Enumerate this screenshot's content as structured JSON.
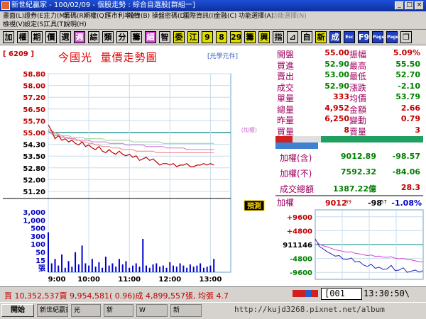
{
  "window": {
    "title": "新世紀贏家 - 100/02/09 - 個股走勢 : 綜合自選股[群組一]"
  },
  "menu": {
    "row1": [
      "畫面(L)",
      "證券(E)",
      "主力(M)",
      "籌碼(R)",
      "期權(Q)",
      "匯市利率(F)",
      "投資(B)",
      "操盤密碼(D)",
      "國際資訊(I)",
      "金融(C)",
      "功能選擇(A)",
      "功能選擇(N)"
    ],
    "row2": [
      "檢視(V)",
      "設定(S)",
      "工具(T)",
      "說明(H)"
    ]
  },
  "toolbar": {
    "buttons": [
      {
        "label": "加",
        "bg": "#d6d3ce",
        "fg": "#000000"
      },
      {
        "label": "權",
        "bg": "#d6d3ce",
        "fg": "#000000"
      },
      {
        "label": "期",
        "bg": "#d6d3ce",
        "fg": "#000000"
      },
      {
        "label": "價",
        "bg": "#d6d3ce",
        "fg": "#000000"
      },
      {
        "label": "選",
        "bg": "#d6d3ce",
        "fg": "#000000"
      },
      {
        "label": "週",
        "bg": "#d050d0",
        "fg": "#ffffff"
      },
      {
        "label": "綜",
        "bg": "#d6d3ce",
        "fg": "#000000"
      },
      {
        "label": "類",
        "bg": "#d6d3ce",
        "fg": "#000000"
      },
      {
        "label": "分",
        "bg": "#d6d3ce",
        "fg": "#000000"
      },
      {
        "label": "籌",
        "bg": "#d6d3ce",
        "fg": "#000000"
      },
      {
        "label": "細",
        "bg": "#d050d0",
        "fg": "#ffffff"
      },
      {
        "label": "智",
        "bg": "#d6d3ce",
        "fg": "#000000"
      },
      {
        "label": "委",
        "bg": "#e0e000",
        "fg": "#000000"
      },
      {
        "label": "江",
        "bg": "#e0e000",
        "fg": "#000000"
      },
      {
        "label": "9",
        "bg": "#e0e000",
        "fg": "#000000"
      },
      {
        "label": "8",
        "bg": "#e0e000",
        "fg": "#000000"
      },
      {
        "label": "29",
        "bg": "#e0e000",
        "fg": "#000000"
      },
      {
        "label": "籌",
        "bg": "#e0e000",
        "fg": "#000000"
      },
      {
        "label": "興",
        "bg": "#e0e000",
        "fg": "#000000"
      },
      {
        "label": "指",
        "bg": "#d6d3ce",
        "fg": "#000000"
      },
      {
        "label": "⊿",
        "bg": "#d6d3ce",
        "fg": "#000000"
      },
      {
        "label": "自",
        "bg": "#d6d3ce",
        "fg": "#000000"
      },
      {
        "label": "新",
        "bg": "#e0e000",
        "fg": "#000000"
      },
      {
        "label": "成",
        "bg": "#2040c0",
        "fg": "#ffffff"
      },
      {
        "label": "Esc",
        "bg": "#2040c0",
        "fg": "#ffffff"
      },
      {
        "label": "F9",
        "bg": "#2040c0",
        "fg": "#ffffff"
      },
      {
        "label": "Page",
        "bg": "#2040c0",
        "fg": "#ffffff"
      },
      {
        "label": "Page",
        "bg": "#2040c0",
        "fg": "#ffffff"
      },
      {
        "label": "❐",
        "bg": "#d6d3ce",
        "fg": "#000000"
      }
    ]
  },
  "stock": {
    "code": "[ 6209 ]",
    "name": "今國光",
    "chart_title": "量價走勢圖",
    "unit": "[光學元件]",
    "index_tag": "(加權)",
    "predict_tag": "預測"
  },
  "quote": {
    "fields": [
      {
        "label": "開盤",
        "value": "55.00",
        "color": "#c00000"
      },
      {
        "label": "振幅",
        "value": "5.09%",
        "color": "#c00000"
      },
      {
        "label": "買進",
        "value": "52.90",
        "color": "#008000"
      },
      {
        "label": "最高",
        "value": "55.50",
        "color": "#008000"
      },
      {
        "label": "賣出",
        "value": "53.00",
        "color": "#008000"
      },
      {
        "label": "最低",
        "value": "52.70",
        "color": "#008000"
      },
      {
        "label": "成交",
        "value": "52.90",
        "color": "#008000"
      },
      {
        "label": "漲跌",
        "value": "-2.10",
        "color": "#008000"
      },
      {
        "label": "單量",
        "value": "333",
        "color": "#c00000"
      },
      {
        "label": "均價",
        "value": "53.79",
        "color": "#008000"
      },
      {
        "label": "總量",
        "value": "4,952",
        "color": "#c00000"
      },
      {
        "label": "金額",
        "value": "2.66",
        "color": "#c00000"
      },
      {
        "label": "昨量",
        "value": "6,250",
        "color": "#c00000"
      },
      {
        "label": "變動",
        "value": "0.79",
        "color": "#c00000"
      },
      {
        "label": "買量",
        "value": "8",
        "color": "#c00000"
      },
      {
        "label": "賣量",
        "value": "3",
        "color": "#c00000"
      }
    ]
  },
  "index_table": [
    {
      "label": "加權(含)",
      "value": "9012.89",
      "change": "-98.57"
    },
    {
      "label": "加權(不)",
      "value": "7592.32",
      "change": "-84.06"
    },
    {
      "label": "成交總額",
      "value": "1387.22億",
      "change": "28.3"
    }
  ],
  "index_chart": {
    "header": {
      "label": "加權",
      "value": "9012",
      "value_small": "89",
      "change": "-98",
      "change_small": "57",
      "pct": "-1.08%"
    },
    "ticks": [
      "+9600",
      "+4800",
      "911146",
      "-4800",
      "-9600"
    ]
  },
  "chart_data": [
    {
      "type": "line",
      "title": "量價走勢圖",
      "x_ticks": [
        "9:00",
        "10:00",
        "11:00",
        "12:00",
        "13:00"
      ],
      "x_range": [
        0,
        270
      ],
      "price_ticks": [
        "58.80",
        "58.00",
        "57.20",
        "56.50",
        "55.70",
        "55.00",
        "54.30",
        "53.50",
        "52.80",
        "52.00",
        "51.20"
      ],
      "ylim": [
        51.2,
        58.8
      ],
      "reference_price": 55.0,
      "volume_ticks": [
        "3,000",
        "1,000",
        "500",
        "300",
        "100",
        "50",
        "15",
        "張"
      ],
      "series": [
        {
          "name": "成交",
          "color": "#c00000",
          "x": [
            0,
            5,
            10,
            15,
            20,
            25,
            30,
            35,
            40,
            45,
            50,
            55,
            60,
            65,
            70,
            75,
            80,
            85,
            90,
            95,
            100,
            105,
            110,
            115,
            120,
            125,
            130,
            135,
            140,
            145,
            150,
            155,
            160,
            165,
            170,
            175,
            180,
            185,
            190,
            195,
            200,
            205,
            210,
            215,
            220,
            225,
            230,
            235,
            240,
            245
          ],
          "y": [
            55.5,
            55.1,
            54.6,
            54.8,
            54.5,
            54.6,
            54.4,
            54.5,
            54.3,
            54.2,
            54.4,
            54.1,
            54.2,
            54.0,
            53.9,
            54.1,
            53.8,
            53.7,
            53.9,
            53.7,
            53.6,
            53.8,
            53.6,
            53.5,
            53.6,
            53.4,
            53.5,
            53.2,
            53.3,
            53.4,
            53.2,
            53.3,
            53.1,
            52.9,
            53.0,
            53.0,
            52.9,
            53.0,
            52.8,
            52.9,
            52.9,
            53.0,
            52.8,
            52.8,
            52.9,
            52.9,
            53.0,
            52.9,
            53.0,
            52.9
          ]
        },
        {
          "name": "均價",
          "color": "#f08080",
          "x": [
            0,
            5,
            10,
            15,
            20,
            25,
            30,
            35,
            40,
            45,
            50,
            55,
            60,
            65,
            70,
            75,
            80,
            85,
            90,
            95,
            100,
            105,
            110,
            115,
            120,
            125,
            130,
            135,
            140,
            145,
            150,
            155,
            160,
            165,
            170,
            175,
            180,
            185,
            190,
            195,
            200,
            205,
            210,
            215,
            220,
            225,
            230,
            235,
            240,
            245
          ],
          "y": [
            55.2,
            55.1,
            55.0,
            54.9,
            54.8,
            54.7,
            54.7,
            54.6,
            54.5,
            54.5,
            54.4,
            54.4,
            54.3,
            54.3,
            54.2,
            54.2,
            54.1,
            54.1,
            54.1,
            54.0,
            54.0,
            54.0,
            53.9,
            53.9,
            53.9,
            53.9,
            53.8,
            53.8,
            53.8,
            53.8,
            53.8,
            53.8,
            53.7,
            53.7,
            53.7,
            53.7,
            53.7,
            53.7,
            53.7,
            53.7,
            53.7,
            53.7,
            53.7,
            53.7,
            53.7,
            53.7,
            53.7,
            53.7,
            53.7,
            53.7
          ]
        },
        {
          "name": "加權",
          "color": "#d070d0",
          "x": [
            0,
            5,
            10,
            15,
            20,
            25,
            30,
            35,
            40,
            45,
            50,
            55,
            60,
            65,
            70,
            75,
            80,
            85,
            90,
            95,
            100,
            105,
            110,
            115,
            120,
            125,
            130,
            135,
            140,
            145,
            150,
            155,
            160,
            165,
            170,
            175,
            180,
            185,
            190,
            195,
            200,
            205,
            210,
            215,
            220,
            225,
            230,
            235,
            240,
            245
          ],
          "y": [
            55.1,
            54.9,
            54.8,
            54.8,
            54.7,
            54.7,
            54.6,
            54.6,
            54.6,
            54.5,
            54.5,
            54.5,
            54.5,
            54.4,
            54.4,
            54.4,
            54.4,
            54.4,
            54.3,
            54.3,
            54.3,
            54.3,
            54.3,
            54.2,
            54.2,
            54.2,
            54.2,
            54.2,
            54.2,
            54.1,
            54.1,
            54.1,
            54.1,
            54.1,
            54.1,
            54.0,
            54.0,
            54.0,
            54.0,
            54.0,
            54.0,
            53.9,
            53.9,
            53.9,
            53.9,
            53.9,
            53.9,
            53.9,
            53.9,
            53.9
          ]
        },
        {
          "name": "加權(不)",
          "color": "#90d090",
          "x": [
            0,
            5,
            10,
            15,
            20,
            25,
            30,
            35,
            40,
            45,
            50,
            55,
            60,
            65,
            70,
            75,
            80,
            85,
            90,
            95,
            100,
            105,
            110,
            115,
            120,
            125,
            130,
            135,
            140,
            145,
            150,
            155,
            160,
            165,
            170,
            175,
            180,
            185,
            190,
            195,
            200,
            205,
            210,
            215,
            220,
            225,
            230,
            235,
            240,
            245
          ],
          "y": [
            55.1,
            55.0,
            54.9,
            54.9,
            54.8,
            54.8,
            54.8,
            54.7,
            54.7,
            54.7,
            54.7,
            54.6,
            54.6,
            54.6,
            54.6,
            54.6,
            54.6,
            54.5,
            54.5,
            54.5,
            54.5,
            54.5,
            54.5,
            54.5,
            54.5,
            54.4,
            54.4,
            54.4,
            54.4,
            54.4,
            54.4,
            54.4,
            54.4,
            54.4,
            54.3,
            54.3,
            54.3,
            54.3,
            54.3,
            54.3,
            54.3,
            54.3,
            54.3,
            54.3,
            54.3,
            54.3,
            54.3,
            54.3,
            54.3,
            54.3
          ]
        }
      ],
      "volume": [
        180,
        40,
        60,
        30,
        80,
        20,
        50,
        25,
        90,
        35,
        120,
        40,
        30,
        60,
        25,
        45,
        20,
        70,
        30,
        40,
        25,
        60,
        35,
        50,
        20,
        30,
        40,
        25,
        150,
        30,
        20,
        35,
        40,
        25,
        30,
        20,
        45,
        30,
        25,
        40,
        30,
        20,
        35,
        25,
        30,
        40,
        20,
        25,
        30,
        60
      ]
    },
    {
      "type": "line",
      "x_range": [
        0,
        270
      ],
      "ylim": [
        -12000,
        12000
      ],
      "series": [
        {
          "name": "加權(含)",
          "color": "#2020c0",
          "x": [
            0,
            10,
            20,
            30,
            40,
            50,
            60,
            70,
            80,
            90,
            100,
            110,
            120,
            130,
            140,
            150,
            160,
            170,
            180,
            190,
            200,
            210,
            220,
            230,
            240,
            250,
            260,
            270
          ],
          "y": [
            2000,
            -600,
            -1500,
            -2500,
            -3200,
            -4000,
            -3800,
            -5000,
            -5200,
            -4600,
            -6000,
            -5800,
            -7000,
            -7600,
            -6800,
            -8200,
            -7800,
            -8600,
            -8400,
            -7200,
            -9000,
            -8800,
            -8000,
            -9600,
            -9200,
            -8800,
            -9500,
            -9000
          ]
        },
        {
          "name": "加權(不)",
          "color": "#d040d0",
          "x": [
            0,
            10,
            20,
            30,
            40,
            50,
            60,
            70,
            80,
            90,
            100,
            110,
            120,
            130,
            140,
            150,
            160,
            170,
            180,
            190,
            200,
            210,
            220,
            230,
            240,
            250,
            260,
            270
          ],
          "y": [
            1500,
            200,
            -400,
            -800,
            -1300,
            -1800,
            -2000,
            -2400,
            -2600,
            -2500,
            -3000,
            -3200,
            -3500,
            -3800,
            -3600,
            -4100,
            -4000,
            -4300,
            -4400,
            -4200,
            -4700,
            -4900,
            -4800,
            -5200,
            -5300,
            -5600,
            -5900,
            -6000
          ]
        }
      ]
    }
  ],
  "statusbar": {
    "text": "買 10,352,537賣 9,954,581( 0.96)成 4,899,557張, 均張 4.7",
    "code": "[001",
    "time": "13:30:50\\"
  },
  "taskbar": {
    "start": "開始",
    "tasks": [
      "新世紀贏家",
      "光",
      "新",
      "W",
      "新"
    ]
  },
  "watermark": "http://kujd3268.pixnet.net/album"
}
